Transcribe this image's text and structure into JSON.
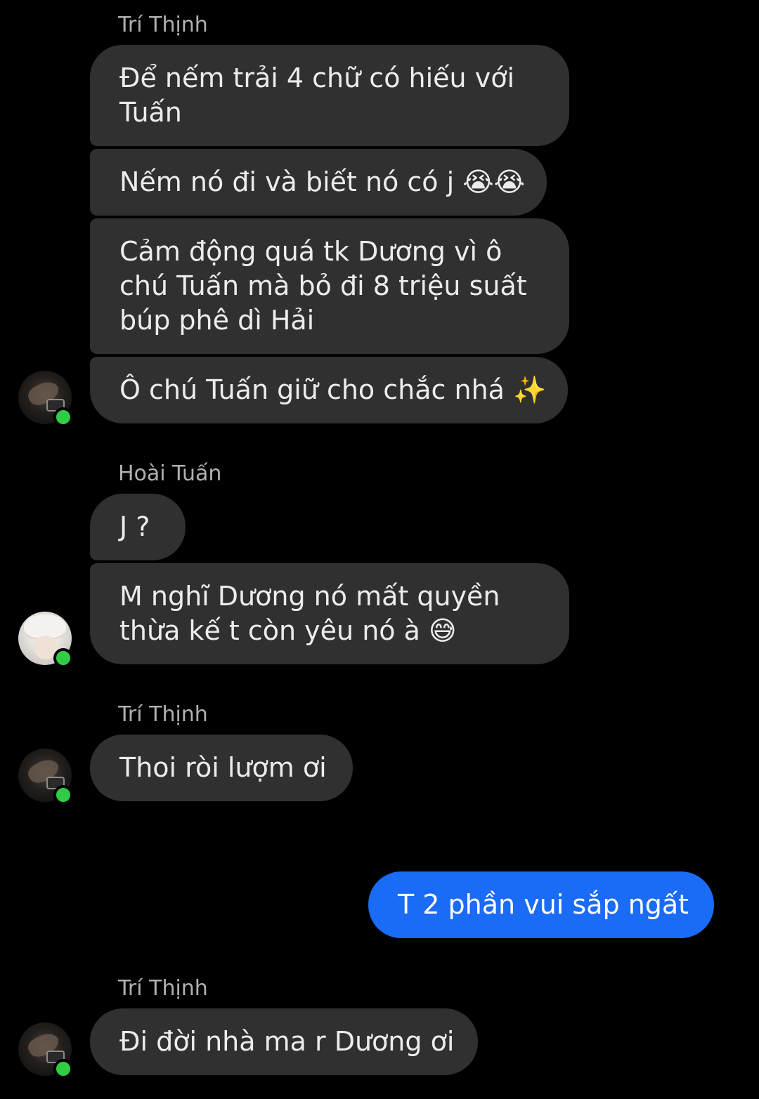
{
  "groups": [
    {
      "sender": "Trí Thịnh",
      "messages": [
        {
          "lines": [
            "Để nếm trải 4 chữ có hiếu với",
            "Tuấn"
          ]
        },
        {
          "lines": [
            "Nếm nó đi và biết nó có j 😭😭"
          ]
        },
        {
          "lines": [
            "Cảm động quá tk Dương vì ô",
            "chú Tuấn mà bỏ đi 8 triệu suất",
            "búp phê dì Hải"
          ]
        },
        {
          "lines": [
            "Ô chú Tuấn giữ cho chắc nhá ✨"
          ]
        }
      ]
    },
    {
      "sender": "Hoài Tuấn",
      "messages": [
        {
          "lines": [
            "J ?"
          ]
        },
        {
          "lines": [
            "M nghĩ Dương nó mất quyền",
            "thừa kế t còn yêu nó à 😅"
          ]
        }
      ]
    },
    {
      "sender": "Trí Thịnh",
      "messages": [
        {
          "lines": [
            "Thoi ròi lượm ơi"
          ]
        }
      ]
    },
    {
      "sender": "",
      "outgoing": true,
      "messages": [
        {
          "lines": [
            "T 2 phần vui sắp ngất"
          ]
        }
      ]
    },
    {
      "sender": "Trí Thịnh",
      "messages": [
        {
          "lines": [
            "Đi đời nhà ma r Dương ơi"
          ]
        }
      ]
    }
  ],
  "colors": {
    "background": "#000000",
    "incoming_bubble": "#303030",
    "outgoing_bubble": "#1a6bf5",
    "sender_name": "#b0b0b0",
    "online_dot": "#31cc46"
  }
}
